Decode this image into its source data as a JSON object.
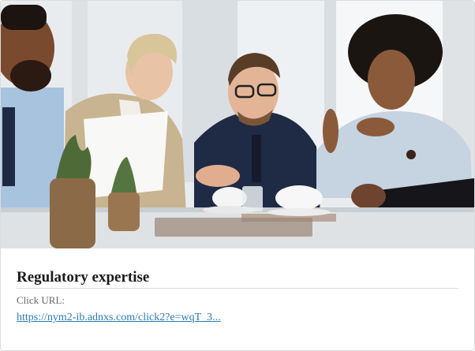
{
  "card": {
    "image_alt": "Business team meeting around a table",
    "title": "Regulatory expertise",
    "click_url_label": "Click URL:",
    "click_url": "https://nym2-ib.adnxs.com/click2?e=wqT_3..."
  },
  "colors": {
    "link": "#2a7ab0",
    "title": "#1a1a1a",
    "label": "#666666"
  }
}
